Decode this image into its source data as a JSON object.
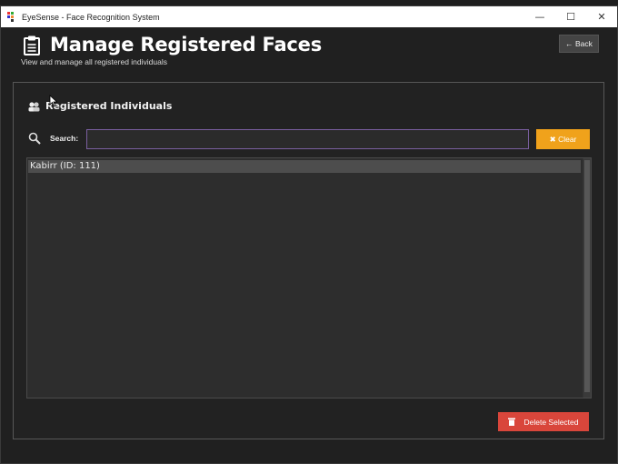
{
  "window": {
    "title": "EyeSense - Face Recognition System",
    "controls": {
      "minimize": "—",
      "maximize": "☐",
      "close": "✕"
    }
  },
  "header": {
    "title": "Manage Registered Faces",
    "subtitle": "View and manage all registered individuals",
    "back_label": "← Back"
  },
  "panel": {
    "section_title": "Registered Individuals",
    "search": {
      "label": "Search:",
      "value": "",
      "placeholder": ""
    },
    "clear_label": "✖ Clear",
    "list": [
      {
        "label": "Kabirr (ID: 111)",
        "selected": true
      }
    ],
    "delete_label": "Delete Selected"
  },
  "colors": {
    "accent_orange": "#f0a21b",
    "danger_red": "#d9463b",
    "input_border": "#7a5fa0",
    "background": "#202020"
  },
  "icons": {
    "app": "eyesense-logo-icon",
    "header": "clipboard-icon",
    "section": "people-icon",
    "search": "magnifier-icon",
    "delete": "trash-icon"
  }
}
